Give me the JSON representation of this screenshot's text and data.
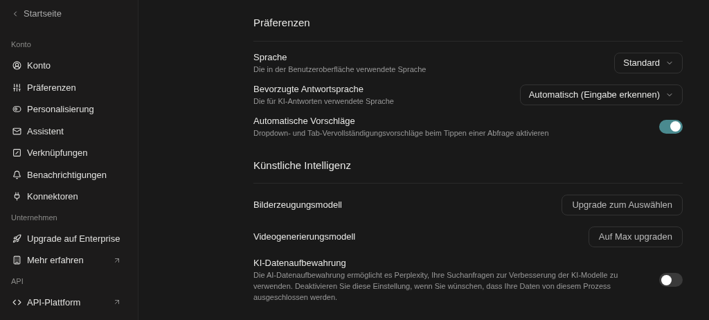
{
  "sidebar": {
    "back": "Startseite",
    "sections": [
      {
        "title": "Konto",
        "items": [
          {
            "label": "Konto",
            "external": false
          },
          {
            "label": "Präferenzen",
            "external": false
          },
          {
            "label": "Personalisierung",
            "external": false
          },
          {
            "label": "Assistent",
            "external": false
          },
          {
            "label": "Verknüpfungen",
            "external": false
          },
          {
            "label": "Benachrichtigungen",
            "external": false
          },
          {
            "label": "Konnektoren",
            "external": false
          }
        ]
      },
      {
        "title": "Unternehmen",
        "items": [
          {
            "label": "Upgrade auf Enterprise",
            "external": false
          },
          {
            "label": "Mehr erfahren",
            "external": true
          }
        ]
      },
      {
        "title": "API",
        "items": [
          {
            "label": "API-Plattform",
            "external": true
          }
        ]
      }
    ]
  },
  "sections": [
    {
      "title": "Präferenzen",
      "settings": [
        {
          "kind": "select",
          "label": "Sprache",
          "description": "Die in der Benutzeroberfläche verwendete Sprache",
          "value": "Standard"
        },
        {
          "kind": "select",
          "label": "Bevorzugte Antwortsprache",
          "description": "Die für KI-Antworten verwendete Sprache",
          "value": "Automatisch (Eingabe erkennen)"
        },
        {
          "kind": "toggle",
          "label": "Automatische Vorschläge",
          "description": "Dropdown- und Tab-Vervollständigungsvorschläge beim Tippen einer Abfrage aktivieren",
          "on": true
        }
      ]
    },
    {
      "title": "Künstliche Intelligenz",
      "settings": [
        {
          "kind": "button",
          "label": "Bilderzeugungsmodell",
          "value": "Upgrade zum Auswählen"
        },
        {
          "kind": "button",
          "label": "Videogenerierungsmodell",
          "value": "Auf Max upgraden"
        },
        {
          "kind": "toggle",
          "label": "KI-Datenaufbewahrung",
          "description": "Die AI-Datenaufbewahrung ermöglicht es Perplexity, Ihre Suchanfragen zur Verbesserung der KI-Modelle zu verwenden. Deaktivieren Sie diese Einstellung, wenn Sie wünschen, dass Ihre Daten von diesem Prozess ausgeschlossen werden.",
          "on": false
        }
      ]
    }
  ]
}
